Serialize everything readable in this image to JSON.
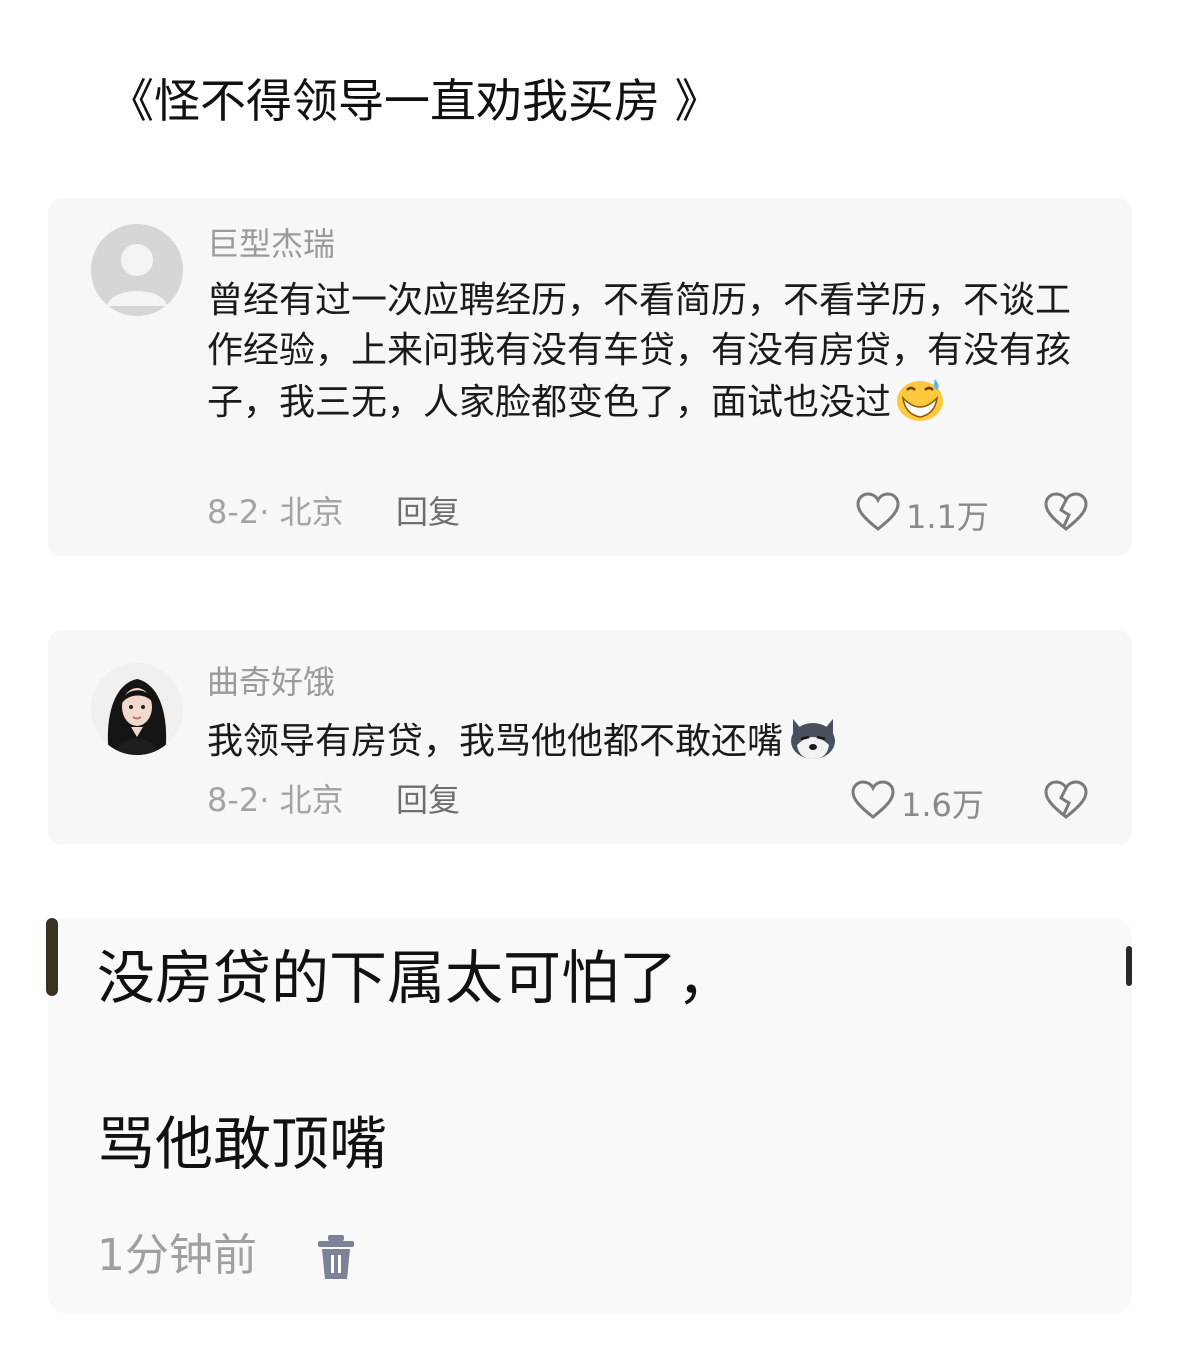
{
  "title": "《怪不得领导一直劝我买房 》",
  "comments": [
    {
      "username": "巨型杰瑞",
      "text": "曾经有过一次应聘经历，不看简历，不看学历，不谈工作经验，上来问我有没有车贷，有没有房贷，有没有孩子，我三无，人家脸都变色了，面试也没过",
      "emoji": "sweat-grin-emoji",
      "date_location": "8-2· 北京",
      "reply_label": "回复",
      "likes": "1.1万"
    },
    {
      "username": "曲奇好饿",
      "text": "我领导有房贷，我骂他他都不敢还嘴",
      "emoji": "husky-dog-emoji",
      "date_location": "8-2· 北京",
      "reply_label": "回复",
      "likes": "1.6万"
    }
  ],
  "own_reply": {
    "line1": "没房贷的下属太可怕了，",
    "line2": "骂他敢顶嘴",
    "time": "1分钟前",
    "delete_icon": "trash-icon"
  },
  "icons": {
    "like": "heart-outline-icon",
    "dislike": "broken-heart-icon",
    "default_avatar": "default-avatar-icon",
    "user_avatar": "woman-portrait-avatar"
  },
  "colors": {
    "username": "#9a9a9a",
    "meta": "#a3a3a3",
    "text": "#1a1a1a",
    "card_background": "#f7f7f7"
  }
}
